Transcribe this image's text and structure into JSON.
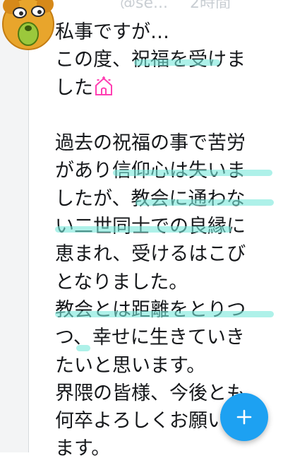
{
  "header": {
    "handle": "@se...",
    "time": "2時間"
  },
  "tweet": {
    "lines": [
      "私事ですが…",
      "この度、祝福を受けま",
      "した",
      "",
      "過去の祝福の事で苦労",
      "があり信仰心は失いま",
      "したが、教会に通わな",
      "い二世同士での良縁に",
      "恵まれ、受けるはこび",
      "となりました。",
      "教会とは距離をとりつ",
      "つ、幸せに生きていき",
      "たいと思います。",
      "界隈の皆様、今後とも",
      "何卒よろしくお願い",
      "ます。"
    ],
    "emoji": "wedding-chapel-emoji"
  },
  "compose": {
    "icon": "plus-icon",
    "color": "#1da1f2"
  },
  "highlight_color": "#78e8da"
}
